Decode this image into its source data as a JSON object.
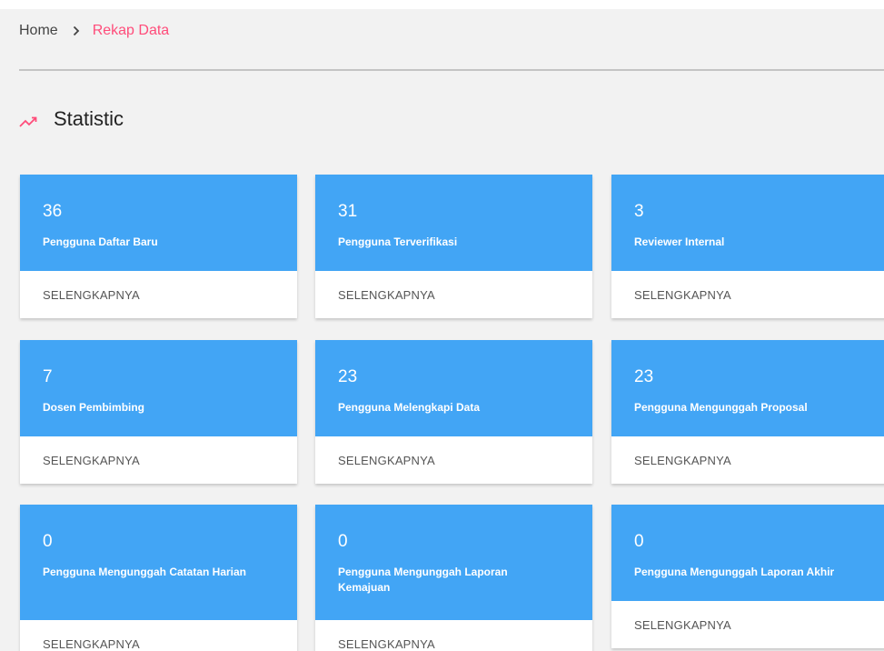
{
  "breadcrumb": {
    "home": "Home",
    "current": "Rekap Data"
  },
  "section": {
    "title": "Statistic",
    "icon": "trending-up-icon"
  },
  "colors": {
    "accent": "#ff4c7a",
    "card_blue": "#42a5f5",
    "page_bg": "#f2f2f2"
  },
  "cards": [
    {
      "value": "36",
      "label": "Pengguna Daftar Baru",
      "link": "SELENGKAPNYA"
    },
    {
      "value": "31",
      "label": "Pengguna Terverifikasi",
      "link": "SELENGKAPNYA"
    },
    {
      "value": "3",
      "label": "Reviewer Internal",
      "link": "SELENGKAPNYA"
    },
    {
      "value": "7",
      "label": "Dosen Pembimbing",
      "link": "SELENGKAPNYA"
    },
    {
      "value": "23",
      "label": "Pengguna Melengkapi Data",
      "link": "SELENGKAPNYA"
    },
    {
      "value": "23",
      "label": "Pengguna Mengunggah Proposal",
      "link": "SELENGKAPNYA"
    },
    {
      "value": "0",
      "label": "Pengguna Mengunggah Catatan Harian",
      "link": "SELENGKAPNYA"
    },
    {
      "value": "0",
      "label": "Pengguna Mengunggah Laporan Kemajuan",
      "link": "SELENGKAPNYA"
    },
    {
      "value": "0",
      "label": "Pengguna Mengunggah Laporan Akhir",
      "link": "SELENGKAPNYA"
    }
  ]
}
